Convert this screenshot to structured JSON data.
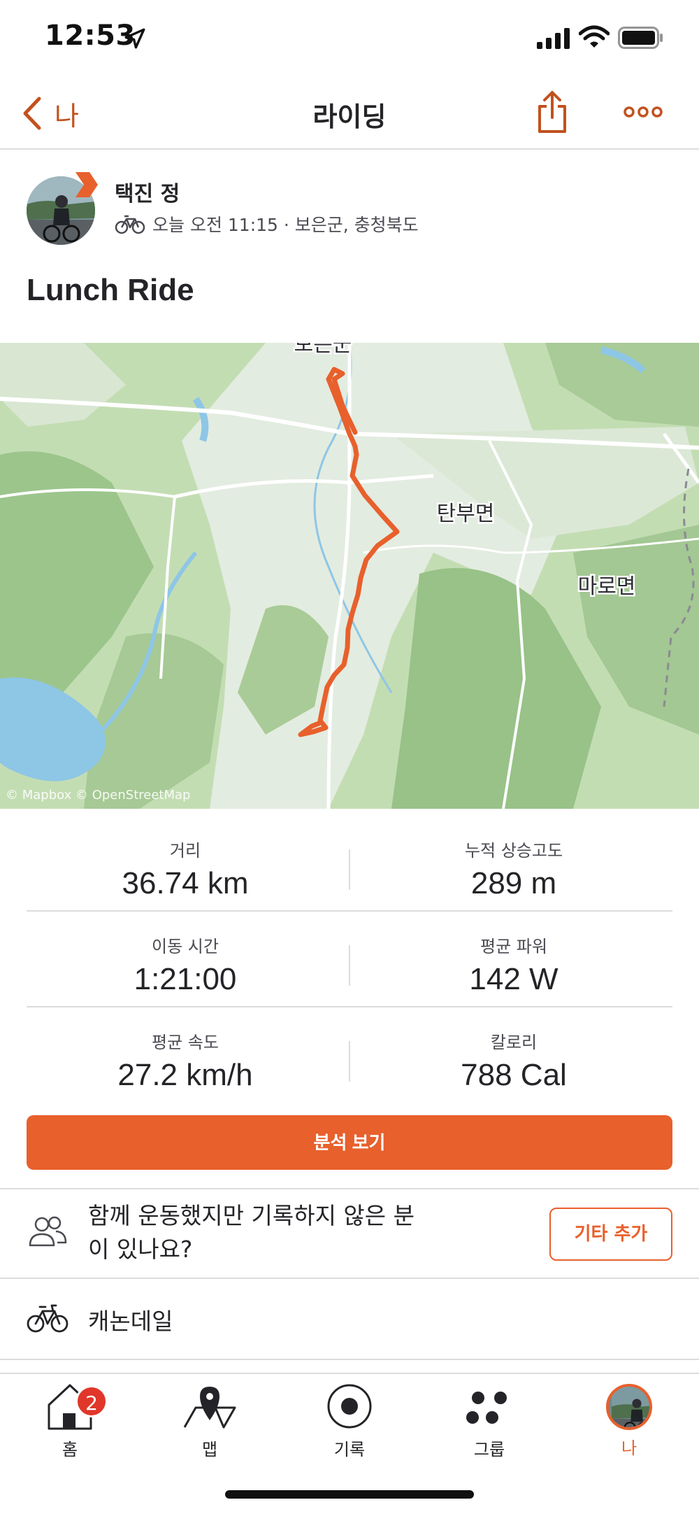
{
  "status_bar": {
    "time": "12:53"
  },
  "nav": {
    "back_label": "나",
    "title": "라이딩"
  },
  "athlete": {
    "name": "택진 정",
    "meta": "오늘 오전 11:15 · 보은군, 충청북도"
  },
  "activity": {
    "title": "Lunch Ride"
  },
  "map": {
    "labels": {
      "top_town": "보은군",
      "area_1": "탄부면",
      "area_2": "마로면"
    },
    "attribution": "© Mapbox © OpenStreetMap",
    "route_color": "#e8602c"
  },
  "stats": [
    {
      "left": {
        "label": "거리",
        "value": "36.74 km"
      },
      "right": {
        "label": "누적 상승고도",
        "value": "289 m"
      }
    },
    {
      "left": {
        "label": "이동 시간",
        "value": "1:21:00"
      },
      "right": {
        "label": "평균 파워",
        "value": "142 W"
      }
    },
    {
      "left": {
        "label": "평균 속도",
        "value": "27.2 km/h"
      },
      "right": {
        "label": "칼로리",
        "value": "788 Cal"
      }
    }
  ],
  "analysis_button": "분석 보기",
  "together": {
    "text": "함께 운동했지만 기록하지 않은 분이 있나요?",
    "add_button": "기타 추가"
  },
  "gear": {
    "label": "캐논데일"
  },
  "tabs": [
    {
      "label": "홈",
      "icon": "home-icon",
      "badge": "2"
    },
    {
      "label": "맵",
      "icon": "map-icon"
    },
    {
      "label": "기록",
      "icon": "record-icon"
    },
    {
      "label": "그룹",
      "icon": "groups-icon"
    },
    {
      "label": "나",
      "icon": "profile-icon",
      "active": true
    }
  ],
  "colors": {
    "accent": "#e8602c",
    "badge": "#e0372a"
  }
}
